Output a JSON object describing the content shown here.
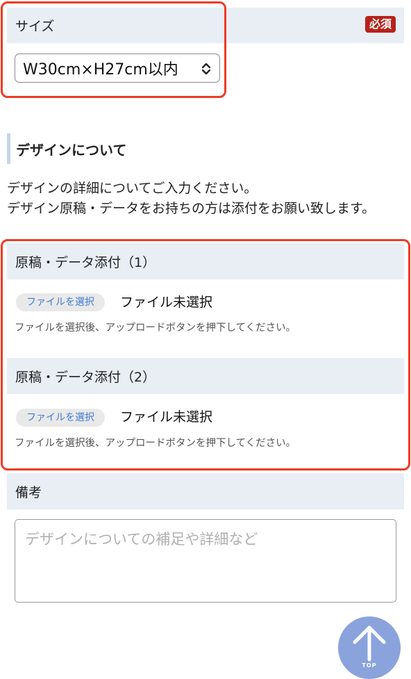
{
  "size": {
    "label": "サイズ",
    "required_badge": "必須",
    "selected_value": "W30cm×H27cm以内"
  },
  "design": {
    "title": "デザインについて",
    "description_1": "デザインの詳細についてご入力ください。",
    "description_2": "デザイン原稿・データをお持ちの方は添付をお願い致します。"
  },
  "attachments": [
    {
      "label": "原稿・データ添付（1）",
      "button_label": "ファイルを選択",
      "status": "ファイル未選択",
      "hint": "ファイルを選択後、アップロードボタンを押下してください。"
    },
    {
      "label": "原稿・データ添付（2）",
      "button_label": "ファイルを選択",
      "status": "ファイル未選択",
      "hint": "ファイルを選択後、アップロードボタンを押下してください。"
    }
  ],
  "notes": {
    "label": "備考",
    "placeholder": "デザインについての補足や詳細など"
  },
  "to_top": {
    "label": "TOP",
    "icon": "arrow-up-icon"
  },
  "colors": {
    "highlight": "#ef3b24",
    "required_badge": "#b8211b",
    "section_bg": "#e8eef4",
    "to_top_bg": "#8aa3dc",
    "file_button_text": "#3d7ad3"
  }
}
